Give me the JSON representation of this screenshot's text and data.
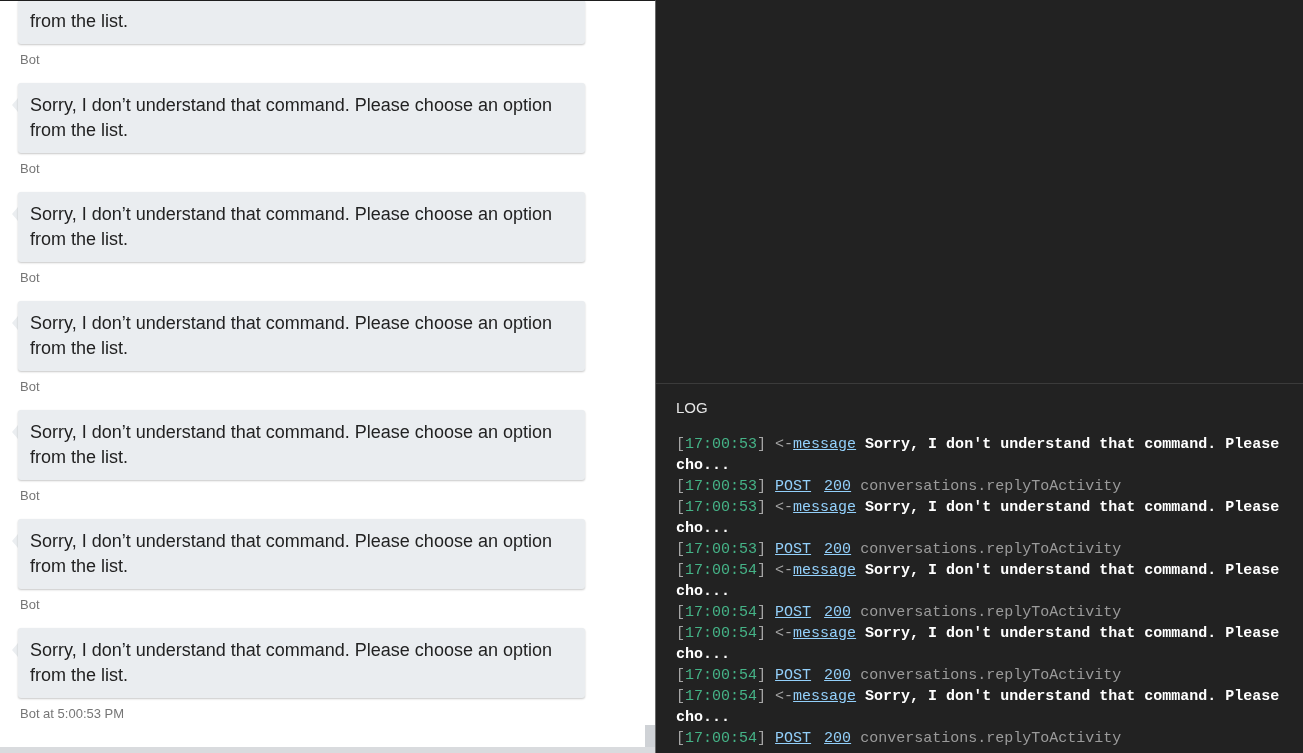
{
  "chat": {
    "messages": [
      {
        "text": "from the list.",
        "sender": "Bot"
      },
      {
        "text": "Sorry, I don’t understand that command. Please choose an option from the list.",
        "sender": "Bot"
      },
      {
        "text": "Sorry, I don’t understand that command. Please choose an option from the list.",
        "sender": "Bot"
      },
      {
        "text": "Sorry, I don’t understand that command. Please choose an option from the list.",
        "sender": "Bot"
      },
      {
        "text": "Sorry, I don’t understand that command. Please choose an option from the list.",
        "sender": "Bot"
      },
      {
        "text": "Sorry, I don’t understand that command. Please choose an option from the list.",
        "sender": "Bot"
      },
      {
        "text": "Sorry, I don’t understand that command. Please choose an option from the list.",
        "sender": "Bot at 5:00:53 PM"
      }
    ]
  },
  "log": {
    "title": "LOG",
    "entries": [
      {
        "kind": "activity",
        "timestamp": "[17:00:53]",
        "direction": "<-",
        "type": "message",
        "text": "Sorry, I don't understand that command. Please cho..."
      },
      {
        "kind": "request",
        "timestamp": "[17:00:53]",
        "method": "POST",
        "status": "200",
        "path": "conversations.replyToActivity"
      },
      {
        "kind": "activity",
        "timestamp": "[17:00:53]",
        "direction": "<-",
        "type": "message",
        "text": "Sorry, I don't understand that command. Please cho..."
      },
      {
        "kind": "request",
        "timestamp": "[17:00:53]",
        "method": "POST",
        "status": "200",
        "path": "conversations.replyToActivity"
      },
      {
        "kind": "activity",
        "timestamp": "[17:00:54]",
        "direction": "<-",
        "type": "message",
        "text": "Sorry, I don't understand that command. Please cho..."
      },
      {
        "kind": "request",
        "timestamp": "[17:00:54]",
        "method": "POST",
        "status": "200",
        "path": "conversations.replyToActivity"
      },
      {
        "kind": "activity",
        "timestamp": "[17:00:54]",
        "direction": "<-",
        "type": "message",
        "text": "Sorry, I don't understand that command. Please cho..."
      },
      {
        "kind": "request",
        "timestamp": "[17:00:54]",
        "method": "POST",
        "status": "200",
        "path": "conversations.replyToActivity"
      },
      {
        "kind": "activity",
        "timestamp": "[17:00:54]",
        "direction": "<-",
        "type": "message",
        "text": "Sorry, I don't understand that command. Please cho..."
      },
      {
        "kind": "request",
        "timestamp": "[17:00:54]",
        "method": "POST",
        "status": "200",
        "path": "conversations.replyToActivity"
      }
    ]
  }
}
